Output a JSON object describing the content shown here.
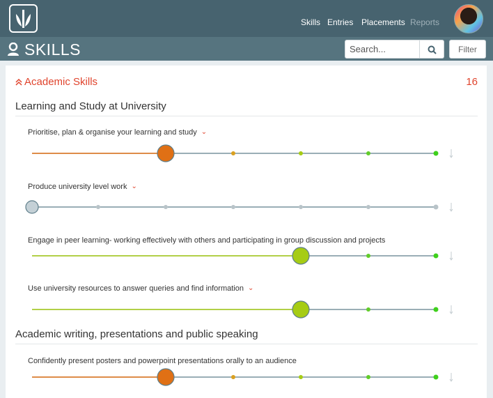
{
  "nav": {
    "items": [
      {
        "label": "Skills",
        "active": true
      },
      {
        "label": "Entries",
        "active": true
      },
      {
        "label": "Placements",
        "active": true
      },
      {
        "label": "Reports",
        "active": false
      }
    ]
  },
  "header": {
    "title": "SKILLS",
    "search_placeholder": "Search...",
    "filter_label": "Filter"
  },
  "section": {
    "title": "Academic Skills",
    "count": "16"
  },
  "groups": [
    {
      "title": "Learning and Study at University"
    },
    {
      "title": "Academic writing, presentations and public speaking"
    }
  ],
  "skills": [
    {
      "label": "Prioritise, plan & organise your learning and study",
      "has_chevron": true,
      "level": 2,
      "color": "orange"
    },
    {
      "label": "Produce university level work",
      "has_chevron": true,
      "level": 0,
      "color": "grey"
    },
    {
      "label": "Engage in peer learning- working effectively with others and participating in group discussion and projects",
      "has_chevron": false,
      "level": 4,
      "color": "lime"
    },
    {
      "label": "Use university resources to answer queries and find information",
      "has_chevron": true,
      "level": 4,
      "color": "lime"
    },
    {
      "label": "Confidently present posters and powerpoint presentations orally to an audience",
      "has_chevron": false,
      "level": 2,
      "color": "orange"
    }
  ],
  "colors": {
    "topbar": "#47636f",
    "titlebar": "#56747f",
    "accent": "#e0442d",
    "orange": "#e07015",
    "lime": "#a6cc14",
    "green": "#3fd01c",
    "track": "#5e7e8a"
  }
}
